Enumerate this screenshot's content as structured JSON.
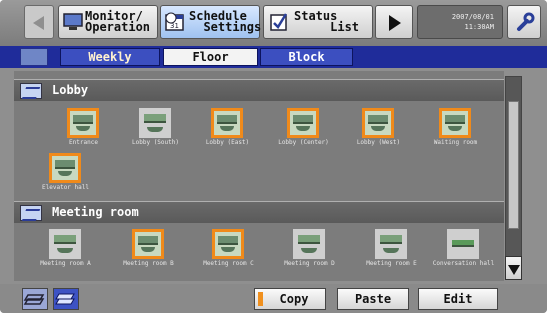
{
  "top_menu": {
    "monitor_label": "Monitor/\nOperation",
    "schedule_label": "Schedule\n  Settings",
    "status_label": "Status\n     List",
    "clock": {
      "date": "2007/08/01",
      "time": "11:30AM"
    }
  },
  "tabs": {
    "weekly": "Weekly",
    "floor": "Floor",
    "block": "Block"
  },
  "groups": [
    {
      "name": "Lobby",
      "units": [
        {
          "label": "Entrance",
          "selected": true
        },
        {
          "label": "Lobby (South)",
          "selected": false
        },
        {
          "label": "Lobby (East)",
          "selected": true
        },
        {
          "label": "Lobby (Center)",
          "selected": true
        },
        {
          "label": "Lobby (West)",
          "selected": true
        },
        {
          "label": "Waiting room",
          "selected": true
        },
        {
          "label": "Elevator hall",
          "selected": true
        }
      ]
    },
    {
      "name": "Meeting room",
      "units": [
        {
          "label": "Meeting room A",
          "selected": false
        },
        {
          "label": "Meeting room B",
          "selected": true
        },
        {
          "label": "Meeting room C",
          "selected": true
        },
        {
          "label": "Meeting room D",
          "selected": false
        },
        {
          "label": "Meeting room E",
          "selected": false
        },
        {
          "label": "Conversation hall",
          "selected": false
        }
      ]
    }
  ],
  "bottom": {
    "copy": "Copy",
    "paste": "Paste",
    "edit": "Edit"
  },
  "colors": {
    "selected_border": "#f08a1a",
    "tab_bar": "#1f2c9a",
    "active_tab": "#f3f3f3"
  }
}
